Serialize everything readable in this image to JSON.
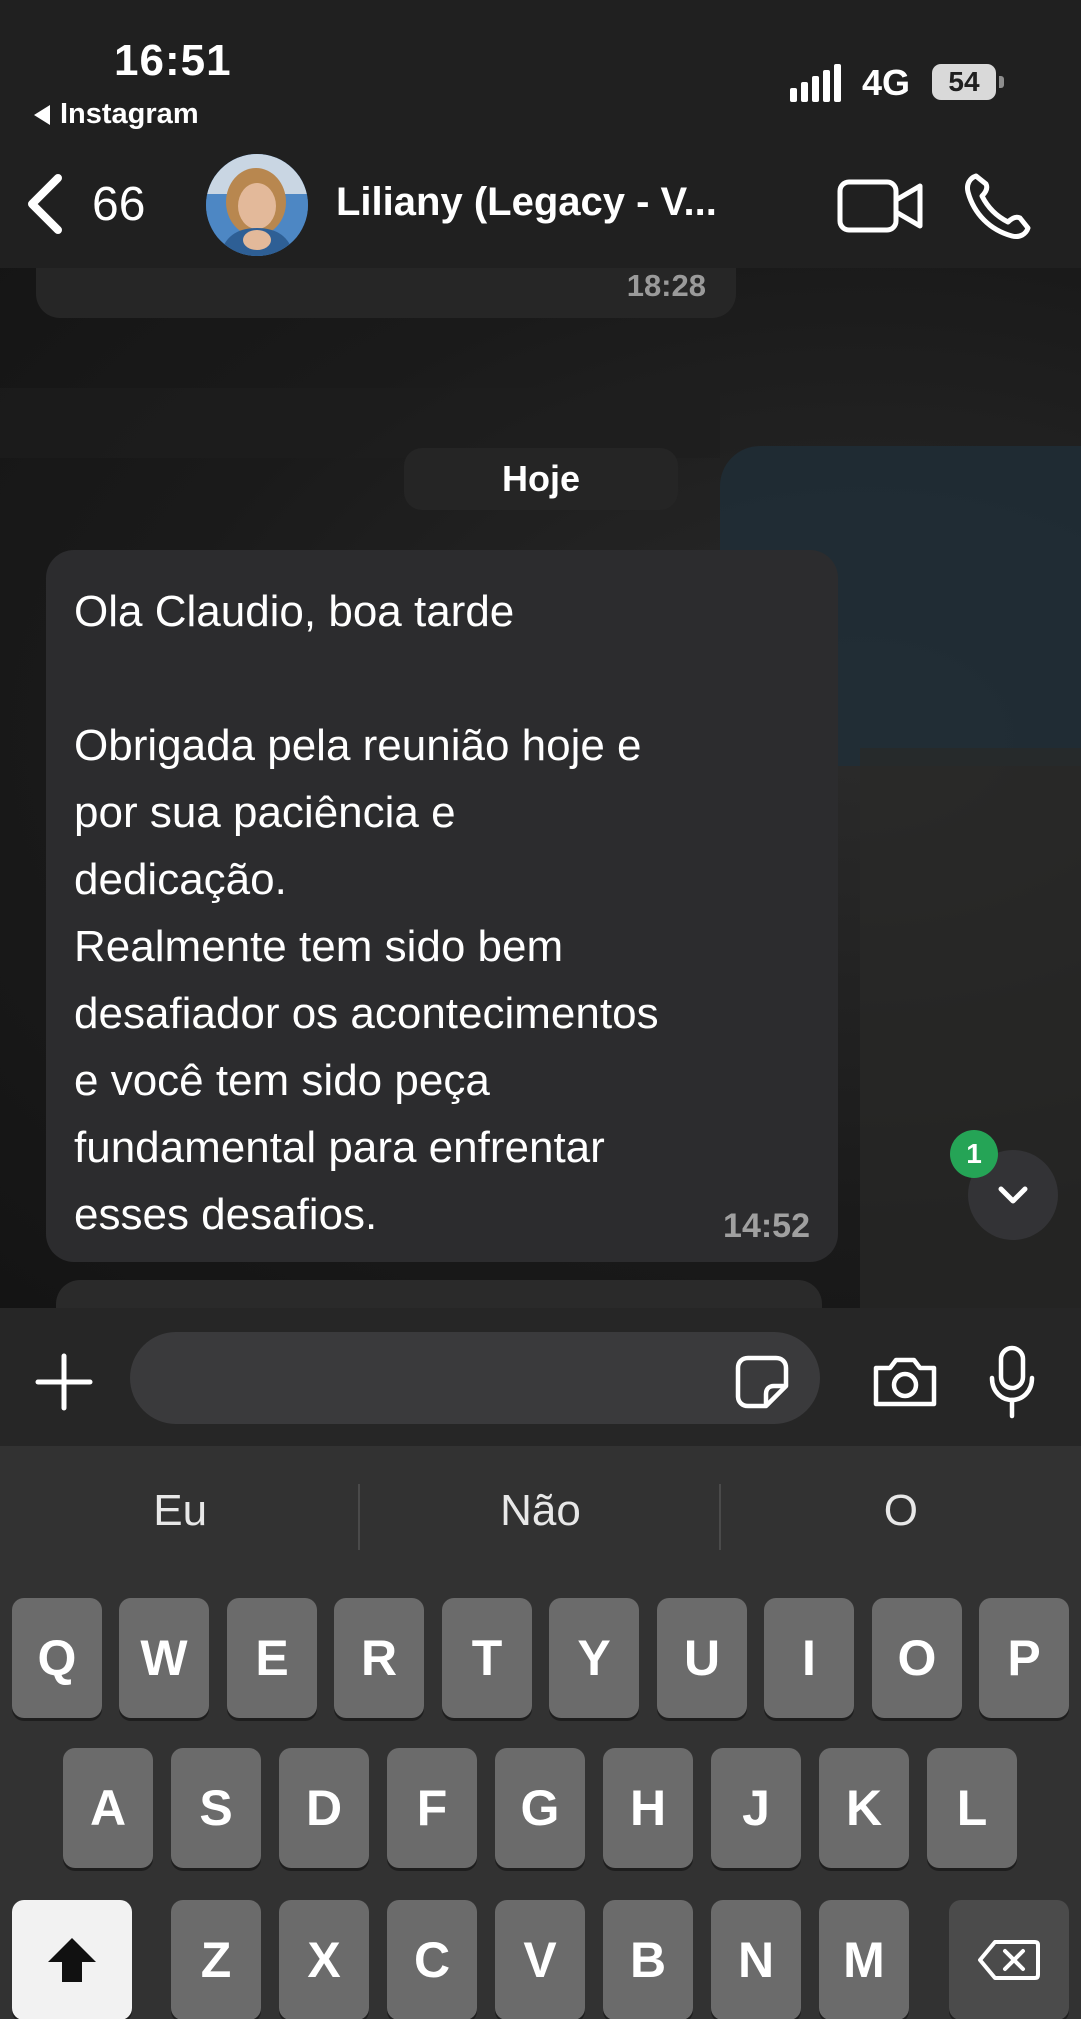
{
  "status_bar": {
    "time": "16:51",
    "back_app": "Instagram",
    "network": "4G",
    "battery": "54"
  },
  "header": {
    "back_count": "66",
    "contact_name": "Liliany (Legacy - V..."
  },
  "chat": {
    "previous_message_time": "18:28",
    "day_separator": "Hoje",
    "message": {
      "text": "Ola Claudio, boa tarde\n\nObrigada pela reunião hoje e\npor sua paciência e\ndedicação.\nRealmente tem sido bem\ndesafiador os acontecimentos\ne você tem sido peça\nfundamental para enfrentar\nesses desafios.",
      "time": "14:52"
    },
    "unread_count": "1"
  },
  "input": {
    "value": "",
    "placeholder": ""
  },
  "keyboard": {
    "suggestions": [
      "Eu",
      "Não",
      "O"
    ],
    "row1": [
      "Q",
      "W",
      "E",
      "R",
      "T",
      "Y",
      "U",
      "I",
      "O",
      "P"
    ],
    "row2": [
      "A",
      "S",
      "D",
      "F",
      "G",
      "H",
      "J",
      "K",
      "L"
    ],
    "row3": [
      "Z",
      "X",
      "C",
      "V",
      "B",
      "N",
      "M"
    ]
  },
  "colors": {
    "badge_green": "#25a456",
    "bubble": "#2c2c2e",
    "header": "#202020"
  }
}
